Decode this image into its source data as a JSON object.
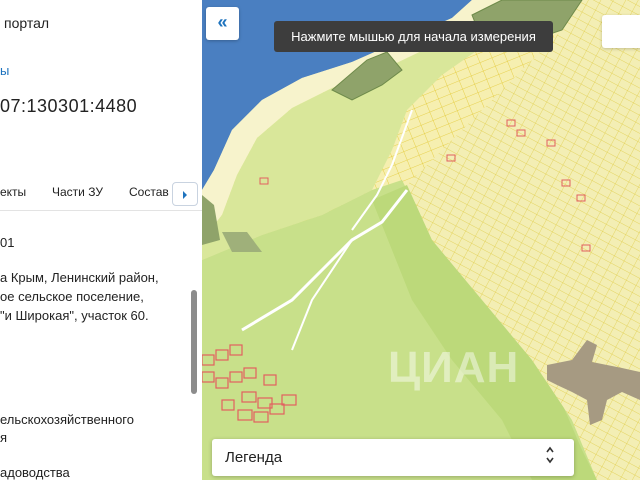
{
  "sidebar": {
    "portal_label": "портал",
    "back_link": "ы",
    "cadastral_number": "07:130301:4480",
    "tabs": [
      {
        "label": "екты"
      },
      {
        "label": "Части ЗУ"
      },
      {
        "label": "Состав"
      }
    ],
    "next_tab_icon": "chevron-right-icon",
    "info_lines": {
      "number_suffix": "01",
      "address_1": "а Крым, Ленинский район,",
      "address_2": "ое сельское поселение,",
      "address_3": "\"и Широкая\", участок 60.",
      "category_1": "ельскохозяйственного",
      "category_2": "я",
      "usage": "адоводства"
    }
  },
  "map": {
    "collapse_icon": "double-chevron-left-icon",
    "collapse_symbol": "«",
    "measure_hint": "Нажмите мышью для начала измерения",
    "legend_label": "Легенда",
    "legend_arrows_icon": "sort-arrows-icon",
    "watermark": "ЦИАН"
  },
  "colors": {
    "accent": "#1e73be",
    "parcel_yellow": "#f6efb0",
    "parcel_line": "#e2c830",
    "field_green": "#c8e08a",
    "water": "#4a7fc1",
    "red_outline": "#e26060",
    "dark_polygon": "#8fa36a",
    "brown_polygon": "#a69a82"
  }
}
